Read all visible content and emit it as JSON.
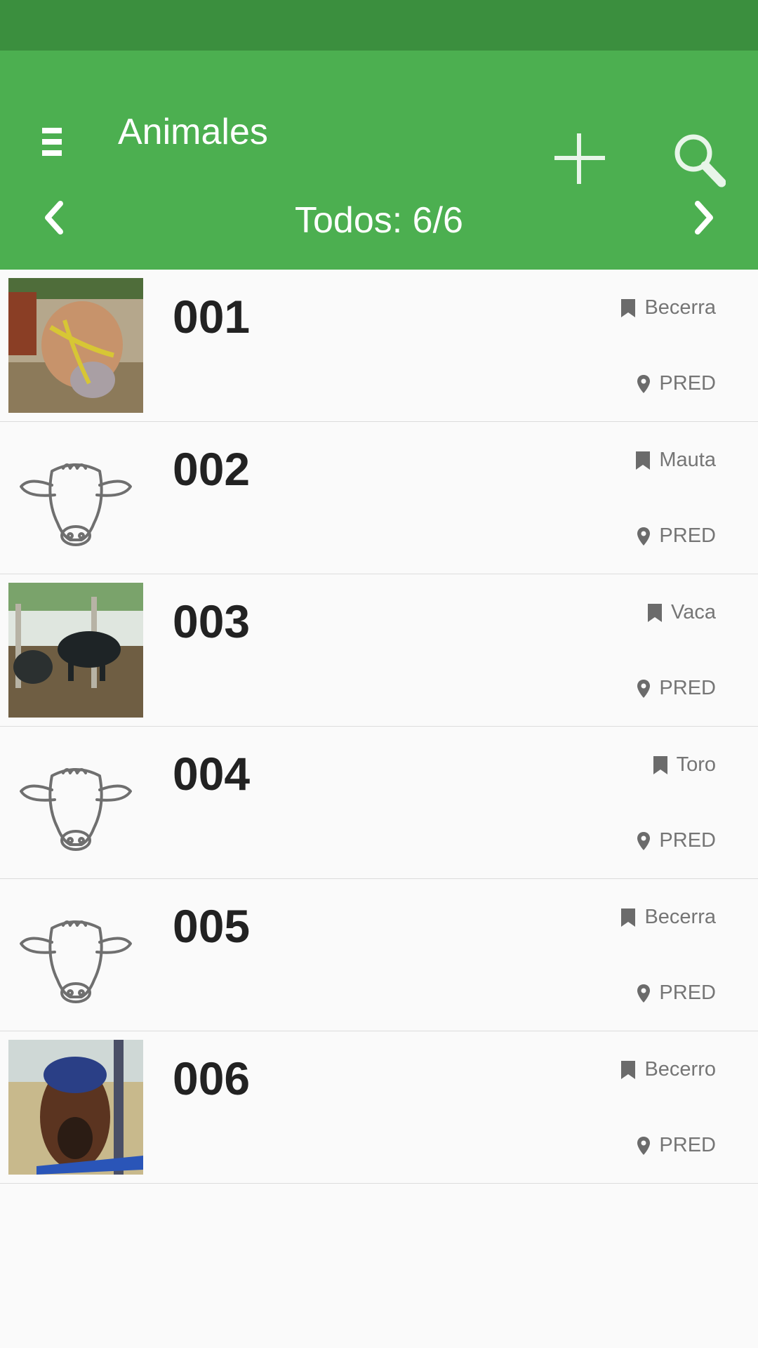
{
  "appbar": {
    "title": "Animales",
    "menu_icon": "hamburger-menu-icon",
    "add_icon": "plus-icon",
    "search_icon": "search-icon"
  },
  "filter": {
    "label": "Todos: 6/6",
    "prev_icon": "chevron-left-icon",
    "next_icon": "chevron-right-icon"
  },
  "colors": {
    "statusbar": "#3b8f3e",
    "appbar": "#4caf50",
    "meta_text": "#757575",
    "id_text": "#222222"
  },
  "animals": [
    {
      "id": "001",
      "category": "Becerra",
      "location": "PRED",
      "thumb": "photo"
    },
    {
      "id": "002",
      "category": "Mauta",
      "location": "PRED",
      "thumb": "cow-head-icon"
    },
    {
      "id": "003",
      "category": "Vaca",
      "location": "PRED",
      "thumb": "photo"
    },
    {
      "id": "004",
      "category": "Toro",
      "location": "PRED",
      "thumb": "cow-head-icon"
    },
    {
      "id": "005",
      "category": "Becerra",
      "location": "PRED",
      "thumb": "cow-head-icon"
    },
    {
      "id": "006",
      "category": "Becerro",
      "location": "PRED",
      "thumb": "photo"
    }
  ]
}
